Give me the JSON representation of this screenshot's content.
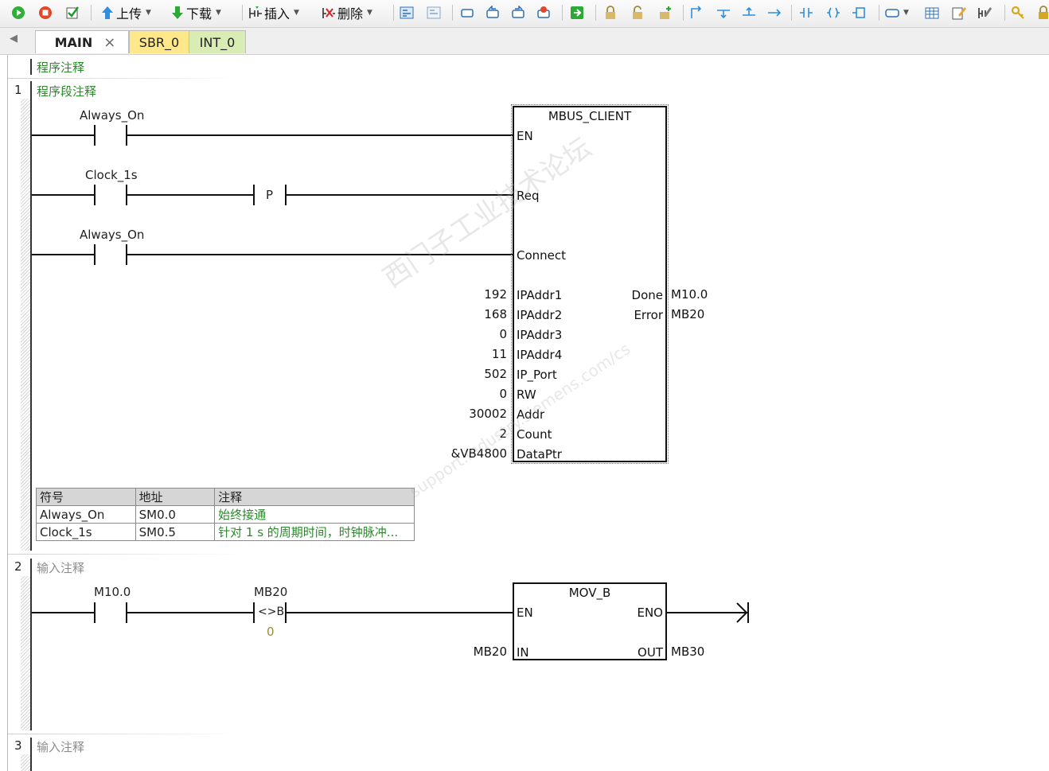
{
  "toolbar": {
    "upload_label": "上传",
    "download_label": "下载",
    "insert_label": "插入",
    "delete_label": "删除"
  },
  "tabs": [
    {
      "label": "MAIN",
      "close": "×"
    },
    {
      "label": "SBR_0"
    },
    {
      "label": "INT_0"
    }
  ],
  "program": {
    "program_comment": "程序注释",
    "networks": [
      {
        "number": "1",
        "comment": "程序段注释",
        "contacts": [
          {
            "label": "Always_On"
          },
          {
            "label": "Clock_1s",
            "edge": "P"
          },
          {
            "label": "Always_On"
          }
        ],
        "block": {
          "title": "MBUS_CLIENT",
          "inputs": [
            "EN",
            "Req",
            "Connect",
            "IPAddr1",
            "IPAddr2",
            "IPAddr3",
            "IPAddr4",
            "IP_Port",
            "RW",
            "Addr",
            "Count",
            "DataPtr"
          ],
          "input_values": [
            "192",
            "168",
            "0",
            "11",
            "502",
            "0",
            "30002",
            "2",
            "&VB4800"
          ],
          "outputs": [
            "Done",
            "Error"
          ],
          "output_values": [
            "M10.0",
            "MB20"
          ]
        },
        "symbol_table": {
          "headers": [
            "符号",
            "地址",
            "注释"
          ],
          "rows": [
            [
              "Always_On",
              "SM0.0",
              "始终接通"
            ],
            [
              "Clock_1s",
              "SM0.5",
              "针对 1 s 的周期时间，时钟脉冲..."
            ]
          ]
        }
      },
      {
        "number": "2",
        "comment": "输入注释",
        "contact": {
          "label": "M10.0"
        },
        "compare": {
          "label": "MB20",
          "op": "<>B",
          "value": "0"
        },
        "block": {
          "title": "MOV_B",
          "en": "EN",
          "eno": "ENO",
          "in": "IN",
          "out": "OUT",
          "in_value": "MB20",
          "out_value": "MB30"
        }
      },
      {
        "number": "3",
        "comment": "输入注释"
      }
    ]
  },
  "watermark": {
    "line1": "西门子工业技术论坛",
    "line2": "support.industry.siemens.com/cs"
  },
  "colors": {
    "comment": "#2a8a2a",
    "placeholder": "#8c8c8c",
    "constant": "#9a8c3a",
    "tab_yellow": "#ffe88a",
    "tab_green": "#d8ecb4"
  }
}
